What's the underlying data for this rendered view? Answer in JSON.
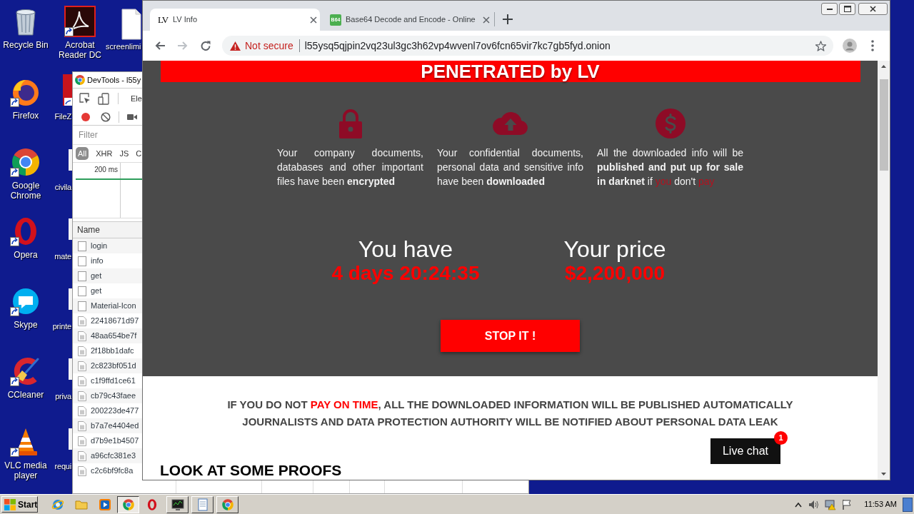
{
  "desktop": {
    "icons": [
      {
        "label": "Recycle Bin",
        "kind": "bin"
      },
      {
        "label": "Firefox",
        "kind": "fox"
      },
      {
        "label": "Google Chrome",
        "kind": "chrome"
      },
      {
        "label": "Opera",
        "kind": "opera"
      },
      {
        "label": "Skype",
        "kind": "skype"
      },
      {
        "label": "CCleaner",
        "kind": "cleaner"
      },
      {
        "label": "VLC media player",
        "kind": "cone"
      },
      {
        "label": "Acrobat Reader DC",
        "kind": "reader"
      },
      {
        "label": "FileZ",
        "kind": "clippedapp"
      },
      {
        "label": "civila",
        "kind": "clippedfile"
      },
      {
        "label": "mate",
        "kind": "clippedfile"
      },
      {
        "label": "printe",
        "kind": "clippedfile"
      },
      {
        "label": "priva",
        "kind": "clippedfile"
      },
      {
        "label": "requi",
        "kind": "clippedfile"
      },
      {
        "label": "screenlimi",
        "kind": "file"
      }
    ]
  },
  "devtools": {
    "title": "DevTools - l55y",
    "panel_tab": "Ele",
    "recording": true,
    "filter_placeholder": "Filter",
    "type_filters": [
      {
        "label": "All",
        "selected": true
      },
      {
        "label": "XHR",
        "selected": false
      },
      {
        "label": "JS",
        "selected": false
      },
      {
        "label": "C",
        "selected": false
      }
    ],
    "timeline_tick": "200 ms",
    "column_header": "Name",
    "requests": [
      {
        "name": "login",
        "kind": "document"
      },
      {
        "name": "info",
        "kind": "document"
      },
      {
        "name": "get",
        "kind": "document"
      },
      {
        "name": "get",
        "kind": "document"
      },
      {
        "name": "Material-Icon",
        "kind": "document"
      },
      {
        "name": "22418671d97",
        "kind": "image"
      },
      {
        "name": "48aa654be7f",
        "kind": "image"
      },
      {
        "name": "2f18bb1dafc",
        "kind": "image"
      },
      {
        "name": "2c823bf051d",
        "kind": "image"
      },
      {
        "name": "c1f9ffd1ce61",
        "kind": "image"
      },
      {
        "name": "cb79c43faee",
        "kind": "image"
      },
      {
        "name": "200223de477",
        "kind": "image"
      },
      {
        "name": "b7a7e4404ed",
        "kind": "image"
      },
      {
        "name": "d7b9e1b4507",
        "kind": "image"
      },
      {
        "name": "a96cfc381e3",
        "kind": "image"
      },
      {
        "name": "c2c6bf9fc8a",
        "kind": "image"
      }
    ]
  },
  "browser": {
    "tabs": [
      {
        "title": "LV Info",
        "icon_text": "LV",
        "kind": "monogram",
        "selected": true
      },
      {
        "title": "Base64 Decode and Encode - Online",
        "icon_text": "B64",
        "kind": "badge",
        "selected": false
      }
    ],
    "security_label": "Not secure",
    "url": "l55ysq5qjpin2vq23ul3gc3h62vp4wvenl7ov6fcn65vir7kc7gb5fyd.onion",
    "page": {
      "banner": "PENETRATED by LV",
      "features": [
        {
          "kind": "lock",
          "segments": [
            {
              "text": "Your company documents, databases and other important files have been ",
              "kind": "plain"
            },
            {
              "text": "encrypted",
              "kind": "bold"
            }
          ]
        },
        {
          "kind": "upload",
          "segments": [
            {
              "text": "Your confidential documents, personal data and sensitive info have been ",
              "kind": "plain"
            },
            {
              "text": "downloaded",
              "kind": "bold"
            }
          ]
        },
        {
          "kind": "dollar",
          "segments": [
            {
              "text": "All the downloaded info will be ",
              "kind": "plain"
            },
            {
              "text": "published and put up for sale in darknet",
              "kind": "bold"
            },
            {
              "text": " if ",
              "kind": "plain"
            },
            {
              "text": "you",
              "kind": "alert"
            },
            {
              "text": " don't ",
              "kind": "plain"
            },
            {
              "text": "pay",
              "kind": "alert"
            }
          ]
        }
      ],
      "countdown": [
        {
          "label": "You have",
          "value": "4 days 20:24:35"
        },
        {
          "label": "Your price",
          "value": "$2,200,000"
        }
      ],
      "action": "STOP IT !",
      "warning_lines": [
        [
          {
            "text": "IF YOU DO NOT ",
            "kind": "plain"
          },
          {
            "text": "PAY ON TIME",
            "kind": "alert"
          },
          {
            "text": ", ALL THE DOWNLOADED INFORMATION WILL BE PUBLISHED AUTOMATICALLY",
            "kind": "plain"
          }
        ],
        [
          {
            "text": "JOURNALISTS AND DATA PROTECTION AUTHORITY WILL BE NOTIFIED ABOUT PERSONAL DATA LEAK",
            "kind": "plain"
          }
        ]
      ],
      "heading": "LOOK AT SOME PROOFS",
      "live_chat": {
        "label": "Live chat",
        "badge": "1"
      }
    }
  },
  "taskbar": {
    "start": "Start",
    "quick_launch": [
      {
        "kind": "globe",
        "selected": false
      },
      {
        "kind": "folder",
        "selected": false
      },
      {
        "kind": "player",
        "selected": false
      },
      {
        "kind": "chrome",
        "selected": true
      },
      {
        "kind": "opera",
        "selected": false
      }
    ],
    "tasks": [
      {
        "kind": "monitor",
        "selected": false
      },
      {
        "kind": "notepad",
        "selected": false
      },
      {
        "kind": "chrome",
        "selected": false
      }
    ],
    "clock": "11:53 AM"
  }
}
